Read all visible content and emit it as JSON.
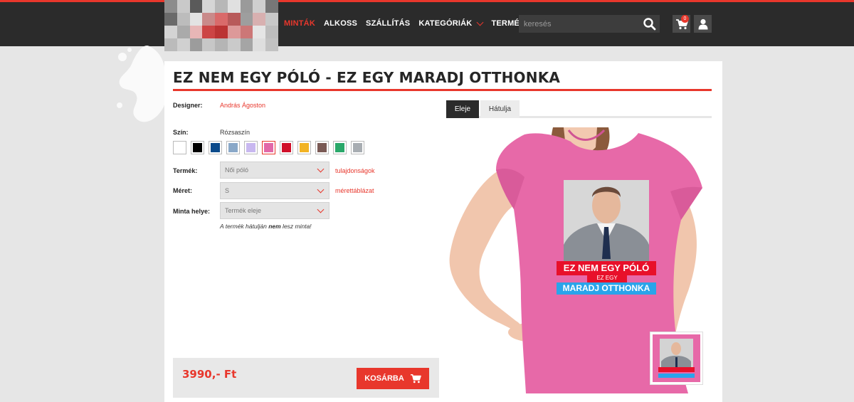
{
  "header": {
    "nav": [
      {
        "label": "MINTÁK",
        "active": true,
        "dropdown": false
      },
      {
        "label": "ALKOSS",
        "active": false,
        "dropdown": false
      },
      {
        "label": "SZÁLLÍTÁS",
        "active": false,
        "dropdown": false
      },
      {
        "label": "KATEGÓRIÁK",
        "active": false,
        "dropdown": true
      },
      {
        "label": "TERMÉKEK",
        "active": false,
        "dropdown": true
      }
    ],
    "search_placeholder": "keresés",
    "cart_count": "0"
  },
  "product": {
    "title": "EZ NEM EGY PÓLÓ - EZ EGY MARADJ OTTHONKA",
    "designer_label": "Designer:",
    "designer_name": "András Ágoston",
    "color_label": "Szín:",
    "color_value": "Rózsaszín",
    "swatches": [
      "#ffffff",
      "#000000",
      "#0b4a8b",
      "#8aa8c8",
      "#c8b8f0",
      "#e268a8",
      "#d0102a",
      "#f2b324",
      "#7a5a55",
      "#2aa86a",
      "#a8adb2"
    ],
    "selected_swatch": 5,
    "product_label": "Termék:",
    "product_value": "Női póló",
    "properties_link": "tulajdonságok",
    "size_label": "Méret:",
    "size_value": "S",
    "size_chart_link": "mérettáblázat",
    "placement_label": "Minta helye:",
    "placement_value": "Termék eleje",
    "note_prefix": "A termék hátulján ",
    "note_bold": "nem",
    "note_suffix": " lesz minta!",
    "price": "3990,- Ft",
    "buy_label": "KOSÁRBA",
    "tabs": [
      "Eleje",
      "Hátulja"
    ],
    "print_line1": "EZ NEM EGY PÓLÓ",
    "print_line2": "EZ EGY",
    "print_line3": "MARADJ OTTHONKA"
  },
  "colors": {
    "accent": "#e8372c",
    "header_bg": "#2b2b2b",
    "shirt": "#e769a8"
  }
}
